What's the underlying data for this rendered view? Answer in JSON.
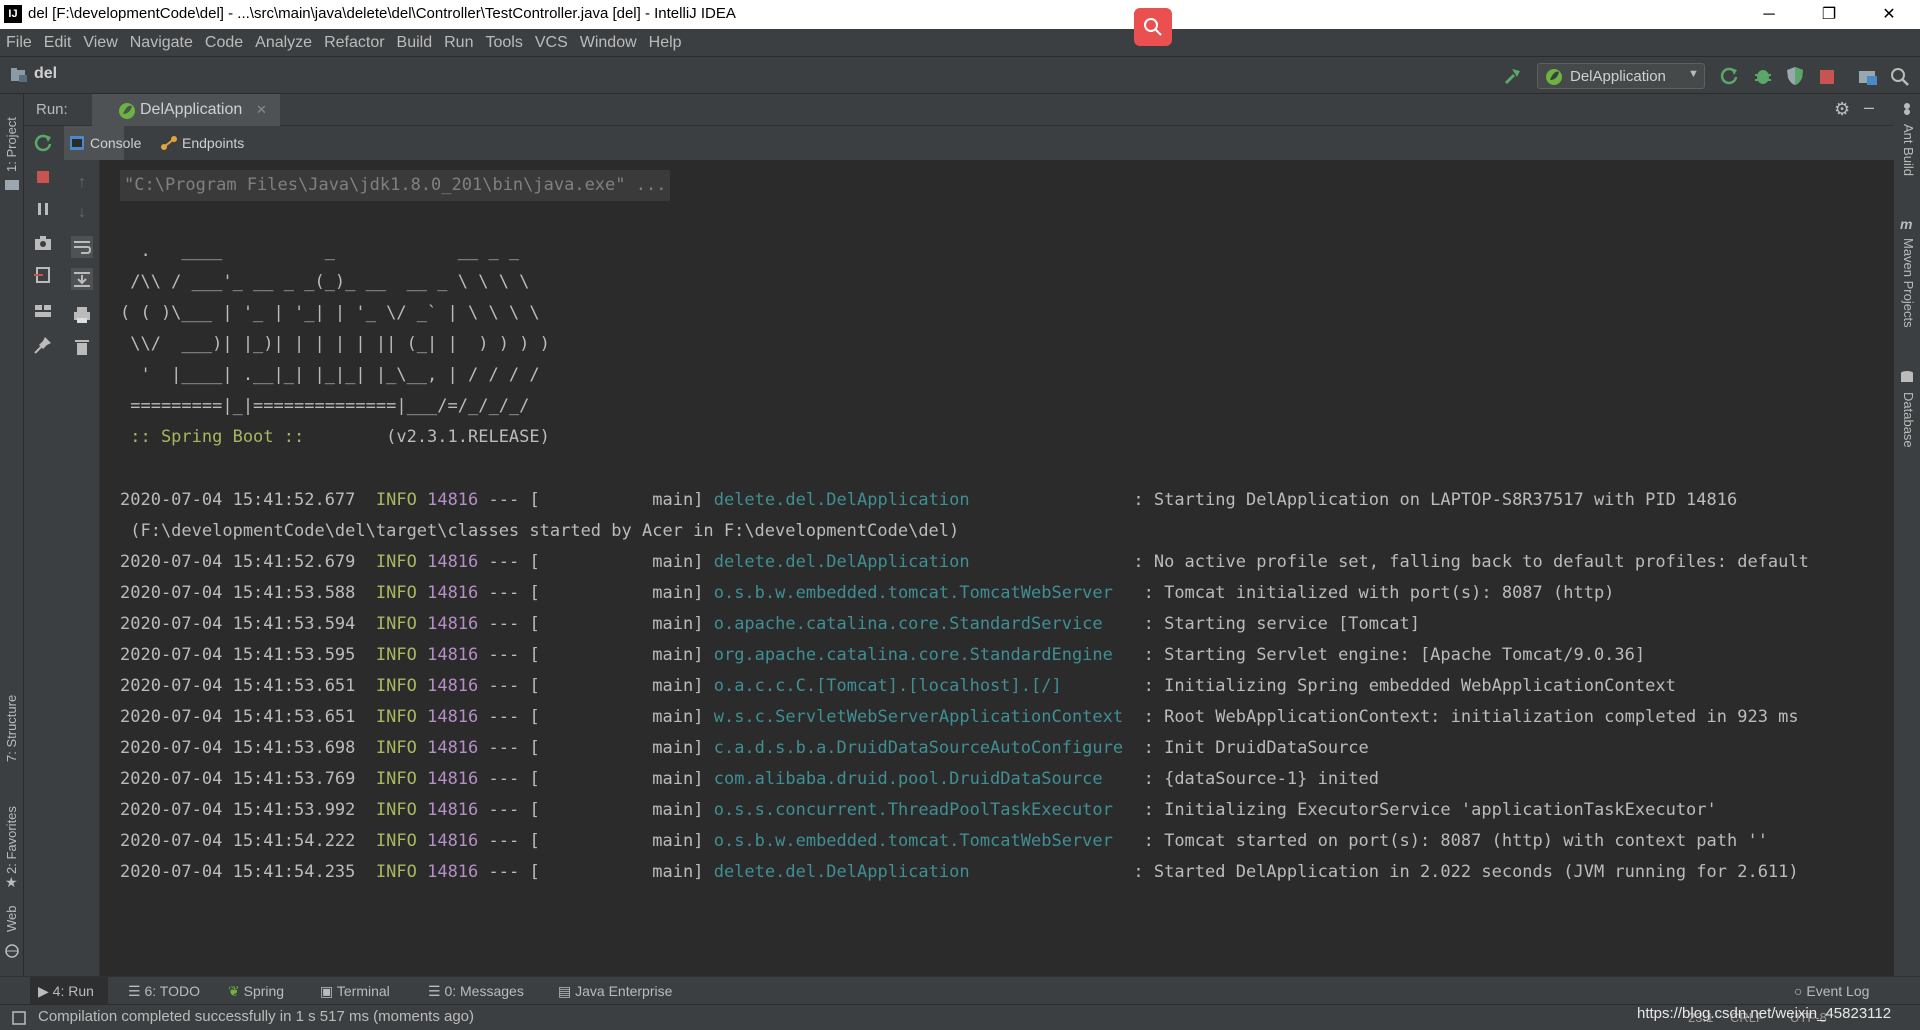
{
  "window": {
    "title": "del [F:\\developmentCode\\del] - ...\\src\\main\\java\\delete\\del\\Controller\\TestController.java [del] - IntelliJ IDEA",
    "minimize": "─",
    "restore": "❐",
    "close": "✕"
  },
  "menu": [
    "File",
    "Edit",
    "View",
    "Navigate",
    "Code",
    "Analyze",
    "Refactor",
    "Build",
    "Run",
    "Tools",
    "VCS",
    "Window",
    "Help"
  ],
  "nav": {
    "project": "del",
    "run_config": "DelApplication"
  },
  "run_panel": {
    "label": "Run:",
    "tab": "DelApplication",
    "subtabs": [
      "Console",
      "Endpoints"
    ]
  },
  "left_stripe": {
    "project": "1: Project",
    "structure": "7: Structure",
    "favorites": "2: Favorites",
    "web": "Web"
  },
  "right_stripe": {
    "ant": "Ant Build",
    "maven": "Maven Projects",
    "database": "Database"
  },
  "console": {
    "command": "\"C:\\Program Files\\Java\\jdk1.8.0_201\\bin\\java.exe\" ...",
    "banner": [
      "  .   ____          _            __ _ _",
      " /\\\\ / ___'_ __ _ _(_)_ __  __ _ \\ \\ \\ \\",
      "( ( )\\___ | '_ | '_| | '_ \\/ _` | \\ \\ \\ \\",
      " \\\\/  ___)| |_)| | | | | || (_| |  ) ) ) )",
      "  '  |____| .__|_| |_|_| |_\\__, | / / / /",
      " =========|_|==============|___/=/_/_/_/"
    ],
    "spring_label": " :: Spring Boot ::",
    "spring_version": "        (v2.3.1.RELEASE)",
    "logs": [
      {
        "ts": "2020-07-04 15:41:52.677",
        "level": "INFO",
        "pid": "14816",
        "sep": "--- [           main]",
        "logger": "delete.del.DelApplication               ",
        "msg": ": Starting DelApplication on LAPTOP-S8R37517 with PID 14816"
      },
      {
        "ts": "",
        "level": "",
        "pid": "",
        "sep": "",
        "logger": "",
        "msg": " (F:\\developmentCode\\del\\target\\classes started by Acer in F:\\developmentCode\\del)"
      },
      {
        "ts": "2020-07-04 15:41:52.679",
        "level": "INFO",
        "pid": "14816",
        "sep": "--- [           main]",
        "logger": "delete.del.DelApplication               ",
        "msg": ": No active profile set, falling back to default profiles: default"
      },
      {
        "ts": "2020-07-04 15:41:53.588",
        "level": "INFO",
        "pid": "14816",
        "sep": "--- [           main]",
        "logger": "o.s.b.w.embedded.tomcat.TomcatWebServer  ",
        "msg": ": Tomcat initialized with port(s): 8087 (http)"
      },
      {
        "ts": "2020-07-04 15:41:53.594",
        "level": "INFO",
        "pid": "14816",
        "sep": "--- [           main]",
        "logger": "o.apache.catalina.core.StandardService   ",
        "msg": ": Starting service [Tomcat]"
      },
      {
        "ts": "2020-07-04 15:41:53.595",
        "level": "INFO",
        "pid": "14816",
        "sep": "--- [           main]",
        "logger": "org.apache.catalina.core.StandardEngine  ",
        "msg": ": Starting Servlet engine: [Apache Tomcat/9.0.36]"
      },
      {
        "ts": "2020-07-04 15:41:53.651",
        "level": "INFO",
        "pid": "14816",
        "sep": "--- [           main]",
        "logger": "o.a.c.c.C.[Tomcat].[localhost].[/]       ",
        "msg": ": Initializing Spring embedded WebApplicationContext"
      },
      {
        "ts": "2020-07-04 15:41:53.651",
        "level": "INFO",
        "pid": "14816",
        "sep": "--- [           main]",
        "logger": "w.s.c.ServletWebServerApplicationContext ",
        "msg": ": Root WebApplicationContext: initialization completed in 923 ms"
      },
      {
        "ts": "2020-07-04 15:41:53.698",
        "level": "INFO",
        "pid": "14816",
        "sep": "--- [           main]",
        "logger": "c.a.d.s.b.a.DruidDataSourceAutoConfigure ",
        "msg": ": Init DruidDataSource"
      },
      {
        "ts": "2020-07-04 15:41:53.769",
        "level": "INFO",
        "pid": "14816",
        "sep": "--- [           main]",
        "logger": "com.alibaba.druid.pool.DruidDataSource   ",
        "msg": ": {dataSource-1} inited"
      },
      {
        "ts": "2020-07-04 15:41:53.992",
        "level": "INFO",
        "pid": "14816",
        "sep": "--- [           main]",
        "logger": "o.s.s.concurrent.ThreadPoolTaskExecutor  ",
        "msg": ": Initializing ExecutorService 'applicationTaskExecutor'"
      },
      {
        "ts": "2020-07-04 15:41:54.222",
        "level": "INFO",
        "pid": "14816",
        "sep": "--- [           main]",
        "logger": "o.s.b.w.embedded.tomcat.TomcatWebServer  ",
        "msg": ": Tomcat started on port(s): 8087 (http) with context path ''"
      },
      {
        "ts": "2020-07-04 15:41:54.235",
        "level": "INFO",
        "pid": "14816",
        "sep": "--- [           main]",
        "logger": "delete.del.DelApplication               ",
        "msg": ": Started DelApplication in 2.022 seconds (JVM running for 2.611)"
      }
    ]
  },
  "bottom_tabs": {
    "run": "4: Run",
    "todo": "6: TODO",
    "spring": "Spring",
    "terminal": "Terminal",
    "messages": "0: Messages",
    "java_ee": "Java Enterprise",
    "event_log": "Event Log"
  },
  "status": {
    "message": "Compilation completed successfully in 1 s 517 ms (moments ago)",
    "watermark": "https://blog.csdn.net/weixin_45823112",
    "position": "23:1",
    "line_sep": "CRLF",
    "encoding": "UTF-8"
  }
}
